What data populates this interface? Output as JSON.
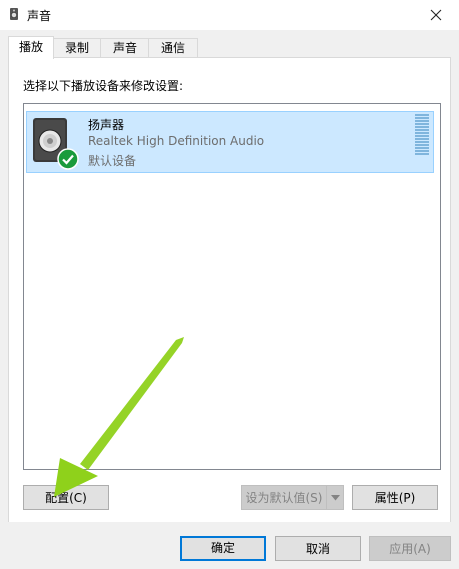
{
  "window": {
    "title": "声音"
  },
  "tabs": [
    {
      "label": "播放",
      "active": true
    },
    {
      "label": "录制",
      "active": false
    },
    {
      "label": "声音",
      "active": false
    },
    {
      "label": "通信",
      "active": false
    }
  ],
  "playback": {
    "instruction": "选择以下播放设备来修改设置:",
    "devices": [
      {
        "name": "扬声器",
        "description": "Realtek High Definition Audio",
        "status": "默认设备",
        "selected": true,
        "icon": "speaker-icon",
        "badge": "default-check-icon"
      }
    ],
    "configure_label": "配置(C)",
    "set_default_label": "设为默认值(S)",
    "properties_label": "属性(P)"
  },
  "footer": {
    "ok_label": "确定",
    "cancel_label": "取消",
    "apply_label": "应用(A)"
  },
  "colors": {
    "selection_bg": "#cce8ff",
    "accent": "#0078d7",
    "annotation_arrow": "#8fd11b",
    "check_badge": "#1a9b3c"
  }
}
